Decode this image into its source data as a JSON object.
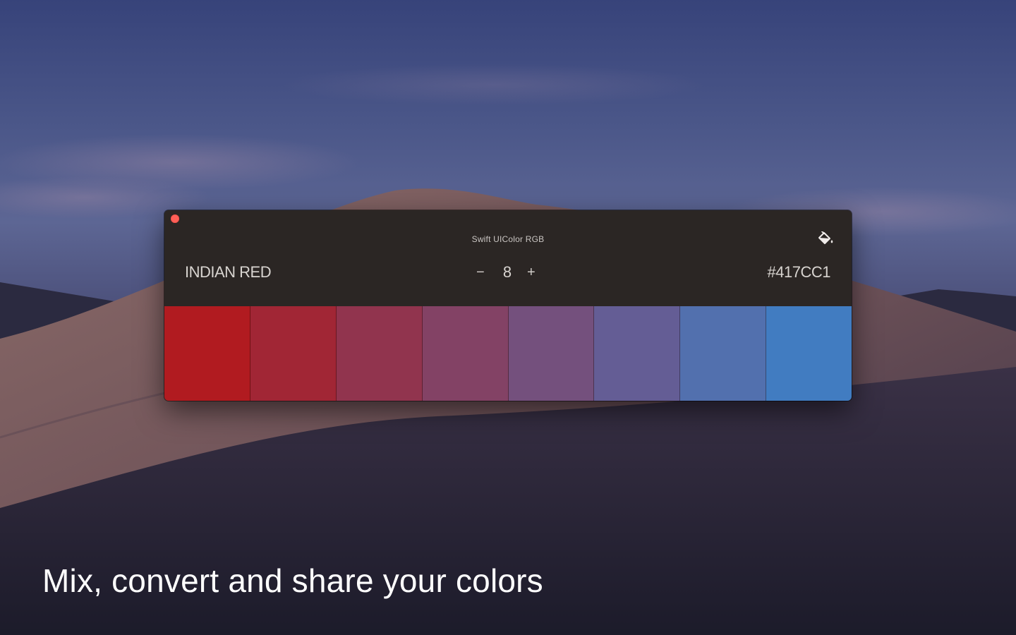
{
  "window": {
    "title": "Swift UIColor RGB",
    "color_name": "INDIAN RED",
    "hex": "#417CC1",
    "stepper": {
      "minus_label": "−",
      "count": "8",
      "plus_label": "+"
    },
    "format_icon": "paint-bucket-icon"
  },
  "swatches": [
    {
      "color": "#B11B20"
    },
    {
      "color": "#A12635"
    },
    {
      "color": "#91344E"
    },
    {
      "color": "#834265"
    },
    {
      "color": "#74507D"
    },
    {
      "color": "#645D95"
    },
    {
      "color": "#5270AE"
    },
    {
      "color": "#417CC1"
    }
  ],
  "tagline": "Mix, convert and share your colors"
}
